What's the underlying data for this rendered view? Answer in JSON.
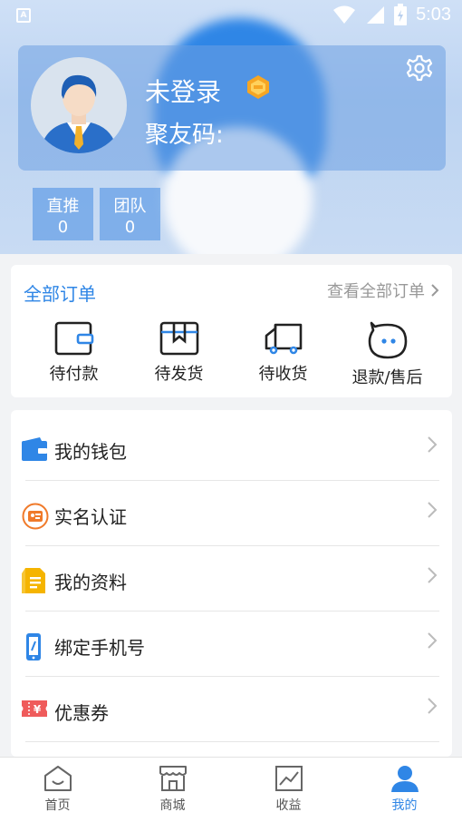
{
  "status_bar": {
    "time": "5:03",
    "left_icon_letter": "A"
  },
  "profile": {
    "name": "未登录",
    "code_label": "聚友码:"
  },
  "stats": [
    {
      "label": "直推",
      "value": "0"
    },
    {
      "label": "团队",
      "value": "0"
    }
  ],
  "orders": {
    "title": "全部订单",
    "view_all": "查看全部订单",
    "items": [
      {
        "label": "待付款",
        "icon": "wallet-icon"
      },
      {
        "label": "待发货",
        "icon": "box-icon"
      },
      {
        "label": "待收货",
        "icon": "truck-icon"
      },
      {
        "label": "退款/售后",
        "icon": "service-icon"
      }
    ]
  },
  "menu": {
    "items": [
      {
        "label": "我的钱包",
        "icon": "wallet-icon"
      },
      {
        "label": "实名认证",
        "icon": "id-card-icon"
      },
      {
        "label": "我的资料",
        "icon": "document-icon"
      },
      {
        "label": "绑定手机号",
        "icon": "phone-icon"
      },
      {
        "label": "优惠券",
        "icon": "coupon-icon"
      }
    ]
  },
  "tabbar": {
    "items": [
      {
        "label": "首页",
        "icon": "home-icon",
        "active": false
      },
      {
        "label": "商城",
        "icon": "store-icon",
        "active": false
      },
      {
        "label": "收益",
        "icon": "chart-icon",
        "active": false
      },
      {
        "label": "我的",
        "icon": "user-icon",
        "active": true
      }
    ]
  },
  "colors": {
    "accent": "#2f86e6",
    "coupon": "#ef5b5b",
    "document": "#f5b400",
    "id_card": "#f07a2a"
  }
}
